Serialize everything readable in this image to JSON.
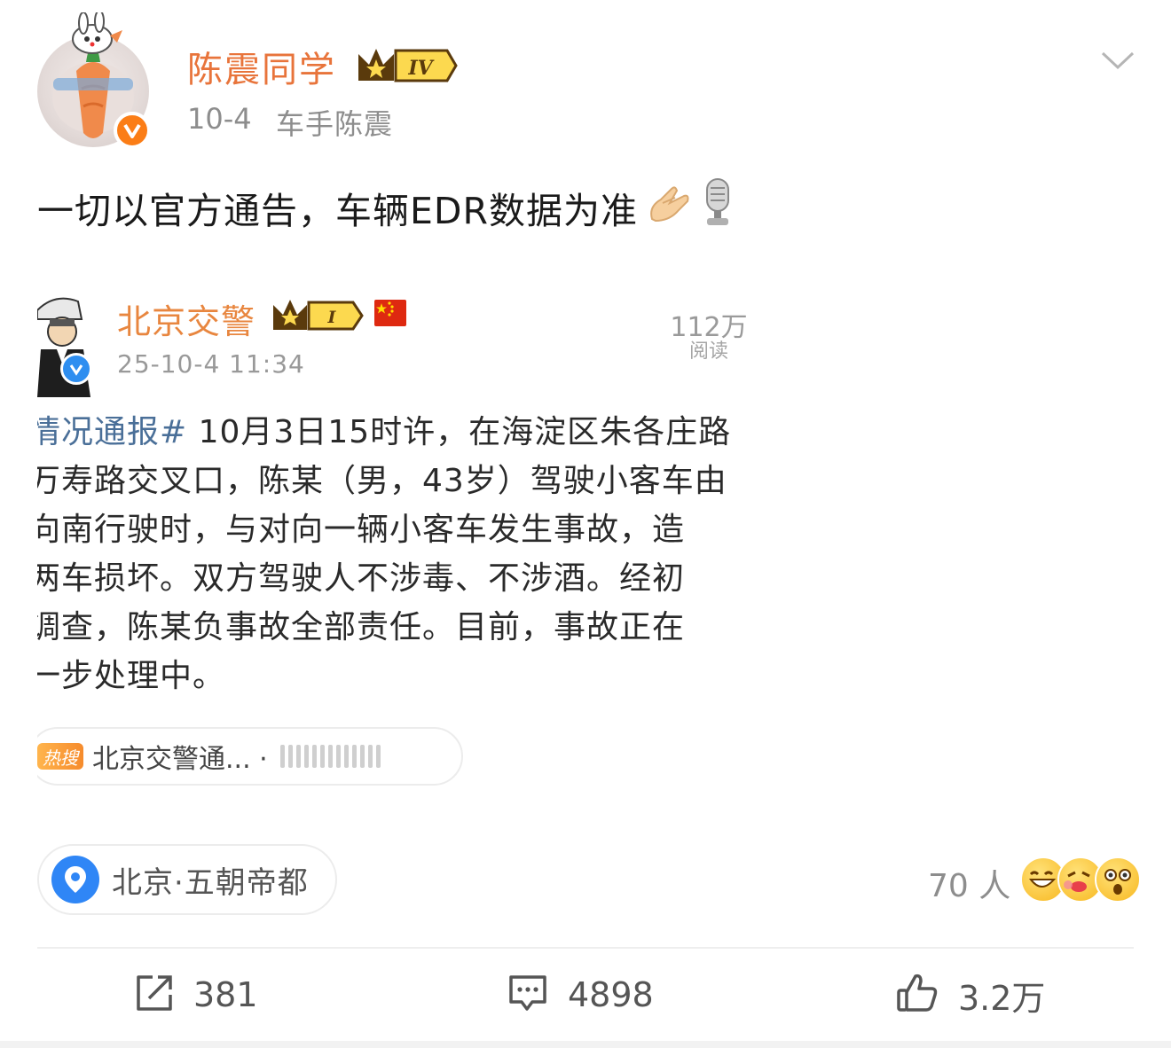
{
  "post": {
    "username": "陈震同学",
    "level_badge": "IV",
    "date": "10-4",
    "source": "车手陈震",
    "text": "一切以官方通告，车辆EDR数据为准",
    "emojis": [
      "pray-hands-icon",
      "microphone-icon"
    ]
  },
  "embedded": {
    "account_name": "北京交警",
    "level_badge": "I",
    "timestamp": "25-10-4 11:34",
    "views": "112万",
    "views_label": "阅读",
    "lines": [
      {
        "hashtag": "情况通报#",
        "text": " 10月3日15时许，在海淀区朱各庄路"
      },
      {
        "hashtag": "",
        "text": "万寿路交叉口，陈某（男，43岁）驾驶小客车由"
      },
      {
        "hashtag": "",
        "text": "向南行驶时，与对向一辆小客车发生事故，造"
      },
      {
        "hashtag": "",
        "text": "两车损坏。双方驾驶人不涉毒、不涉酒。经初"
      },
      {
        "hashtag": "",
        "text": "调查，陈某负事故全部责任。目前，事故正在"
      },
      {
        "hashtag": "",
        "text": "一步处理中。"
      }
    ],
    "hot_tag": "热搜",
    "hot_text": "北京交警通... ·"
  },
  "location": {
    "text": "北京·五朝帝都"
  },
  "reactions": {
    "count": "70 人"
  },
  "actions": {
    "repost": "381",
    "comment": "4898",
    "like": "3.2万"
  },
  "colors": {
    "username": "#e8743b",
    "verified_orange": "#fb7d16",
    "verified_blue": "#2e8ef0",
    "hashtag": "#4a6f98",
    "location_blue": "#2f86f6"
  }
}
